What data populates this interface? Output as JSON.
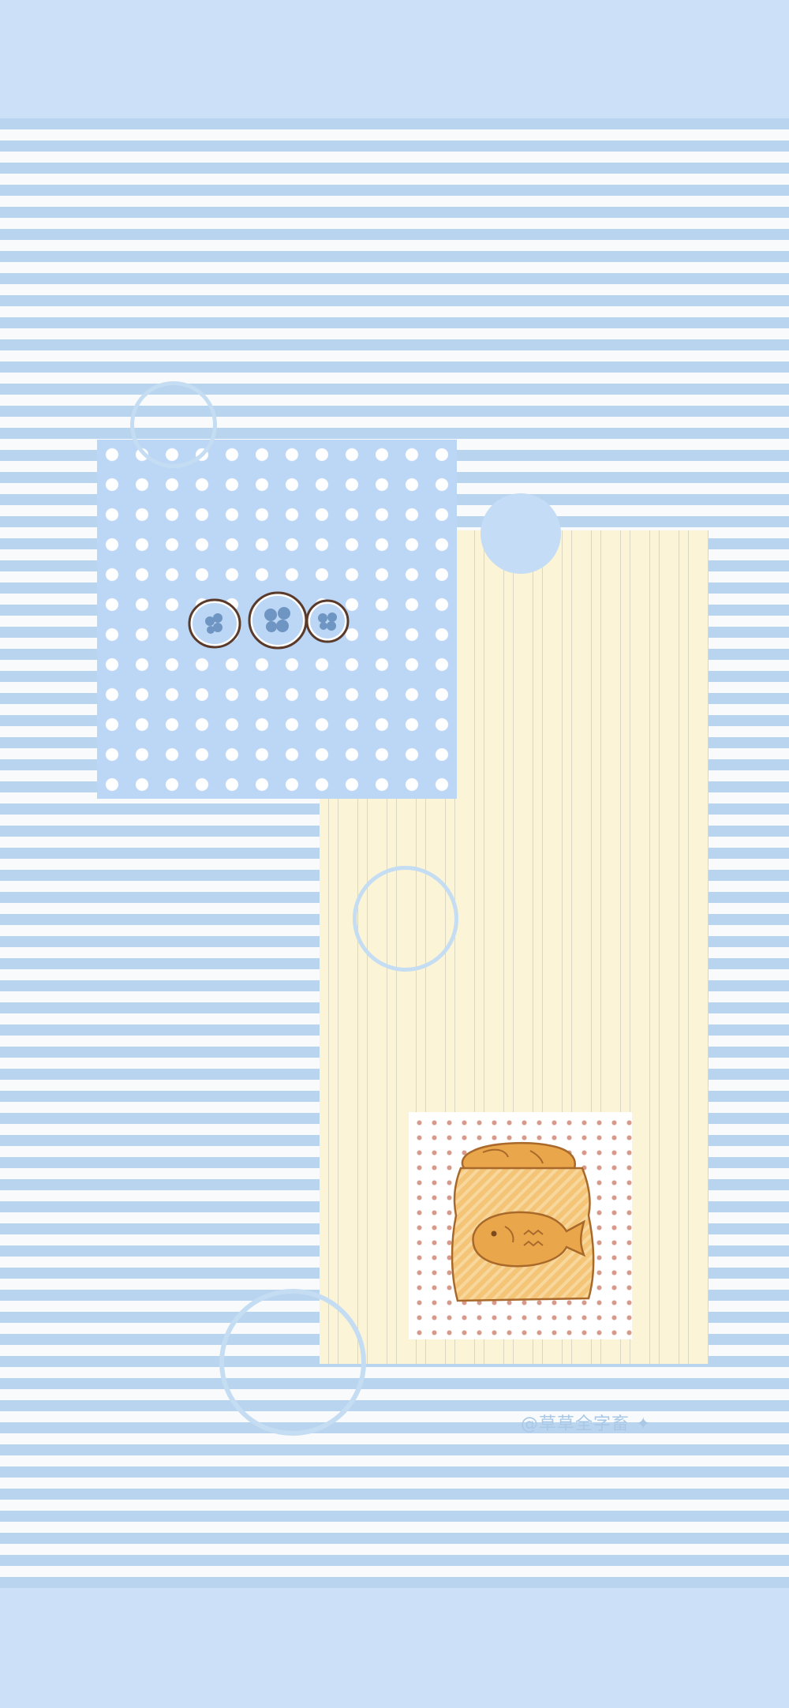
{
  "wallpaper": {
    "colors": {
      "band": "#cce0f7",
      "paper": "#f8fafc",
      "dash": "#b9d4ef",
      "blue_panel": "#bcd6f5",
      "yellow_panel": "#fbf4d6",
      "red_dot": "#d79a8a",
      "ring": "#c5ddf3"
    },
    "decorations": [
      "polka-dot-panel",
      "striped-panel",
      "red-dot-card",
      "ring-circles",
      "blue-disc",
      "clover-cookie-stickers",
      "taiyaki-bag-illustration"
    ],
    "watermark": "@草草全字畜"
  }
}
